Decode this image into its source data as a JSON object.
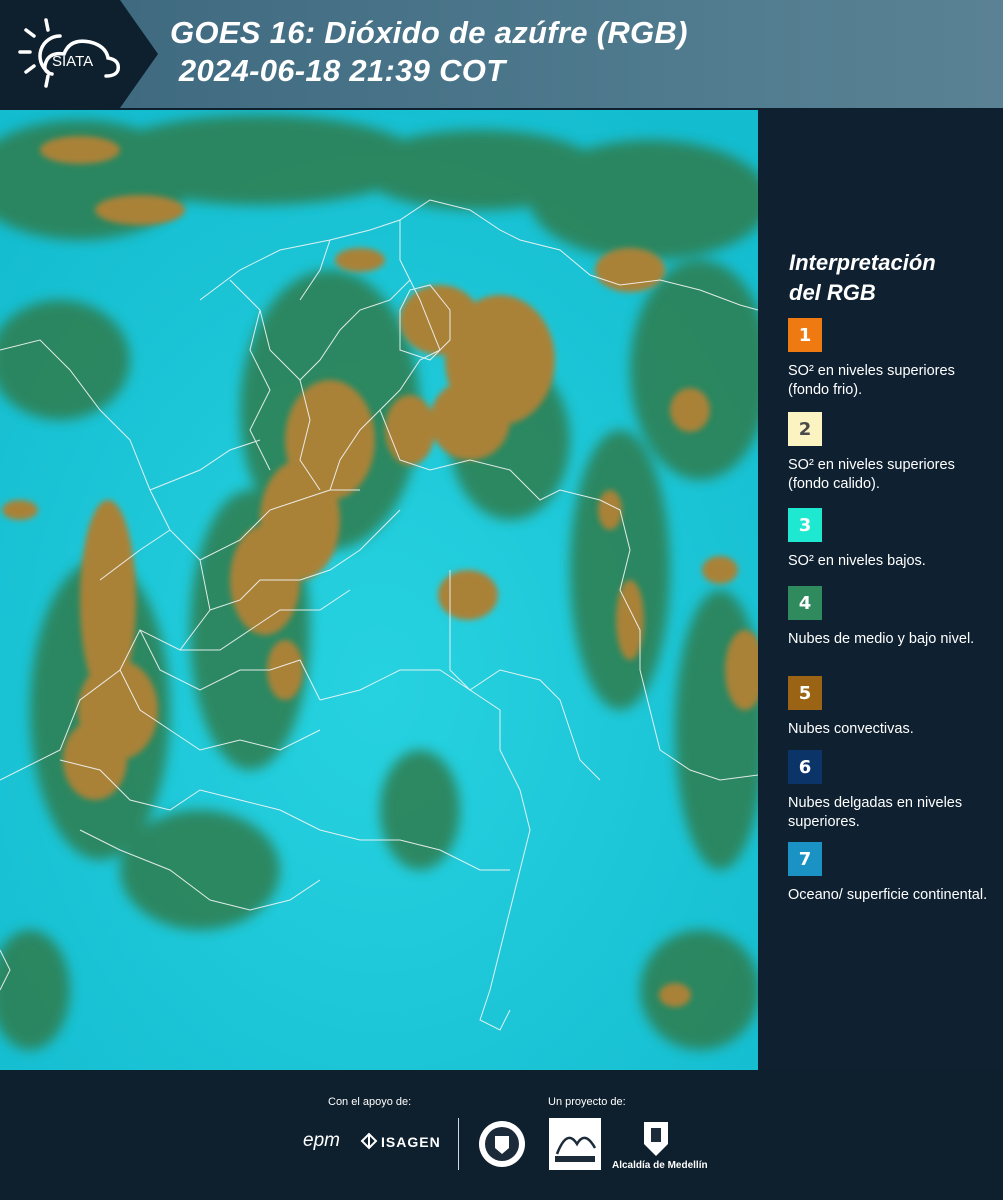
{
  "header": {
    "logo_text": "SIATA",
    "title_line1": "GOES 16: Dióxido de azúfre (RGB)",
    "title_line2": " 2024-06-18 21:39 COT"
  },
  "legend": {
    "title_line1": "Interpretación",
    "title_line2": "del RGB",
    "items": [
      {
        "number": "1",
        "color": "#f07a12",
        "label": "SO² en niveles superiores (fondo frio)."
      },
      {
        "number": "2",
        "color": "#fbf3c2",
        "label": "SO² en niveles superiores (fondo calido)."
      },
      {
        "number": "3",
        "color": "#1ee8d0",
        "label": "SO² en niveles bajos."
      },
      {
        "number": "4",
        "color": "#2f8a5e",
        "label": "Nubes de medio y bajo nivel."
      },
      {
        "number": "5",
        "color": "#9a6414",
        "label": "Nubes convectivas."
      },
      {
        "number": "6",
        "color": "#0b3469",
        "label": "Nubes delgadas en niveles superiores."
      },
      {
        "number": "7",
        "color": "#1a93c4",
        "label": "Oceano/ superficie continental."
      }
    ]
  },
  "footer": {
    "support_label": "Con el apoyo de:",
    "project_label": "Un proyecto de:",
    "sponsors": [
      "epm",
      "ISAGEN"
    ],
    "partners": [
      "Área Metropolitana Valle de Aburrá",
      "Alcaldía de Medellín"
    ]
  },
  "map": {
    "background_color": "#19c9d9",
    "cloud_color": "#a7813b",
    "low_cloud_color": "#2f7f4f"
  }
}
